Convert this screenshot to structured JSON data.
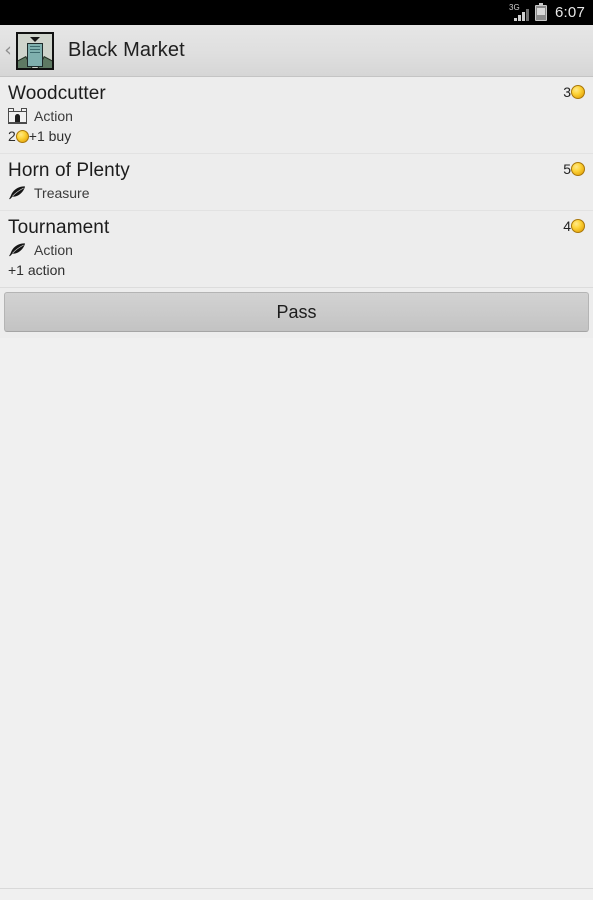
{
  "status_bar": {
    "network_label": "3G",
    "signal_icon": "signal-bars-icon",
    "battery_icon": "battery-icon",
    "time": "6:07"
  },
  "action_bar": {
    "back_icon": "back-chevron-icon",
    "app_icon": "black-market-card-icon",
    "title": "Black Market"
  },
  "cards": [
    {
      "name": "Woodcutter",
      "type": "Action",
      "type_icon": "village-icon",
      "cost": "3",
      "cost_icon": "coin-icon",
      "desc_prefix": "2",
      "desc_icon": "coin-icon",
      "desc_suffix": "+1 buy"
    },
    {
      "name": "Horn of Plenty",
      "type": "Treasure",
      "type_icon": "feather-icon",
      "cost": "5",
      "cost_icon": "coin-icon",
      "desc_prefix": "",
      "desc_icon": "",
      "desc_suffix": ""
    },
    {
      "name": "Tournament",
      "type": "Action",
      "type_icon": "feather-icon",
      "cost": "4",
      "cost_icon": "coin-icon",
      "desc_prefix": "",
      "desc_icon": "",
      "desc_suffix": "+1 action"
    }
  ],
  "pass_button": {
    "label": "Pass"
  },
  "colors": {
    "coin_gold": "#fdd43a",
    "status_bar_bg": "#000000",
    "action_bar_bg": "#dfdfdf",
    "list_bg": "#ededed",
    "page_bg": "#f0f0f0",
    "button_bg": "#cbcbcb"
  }
}
